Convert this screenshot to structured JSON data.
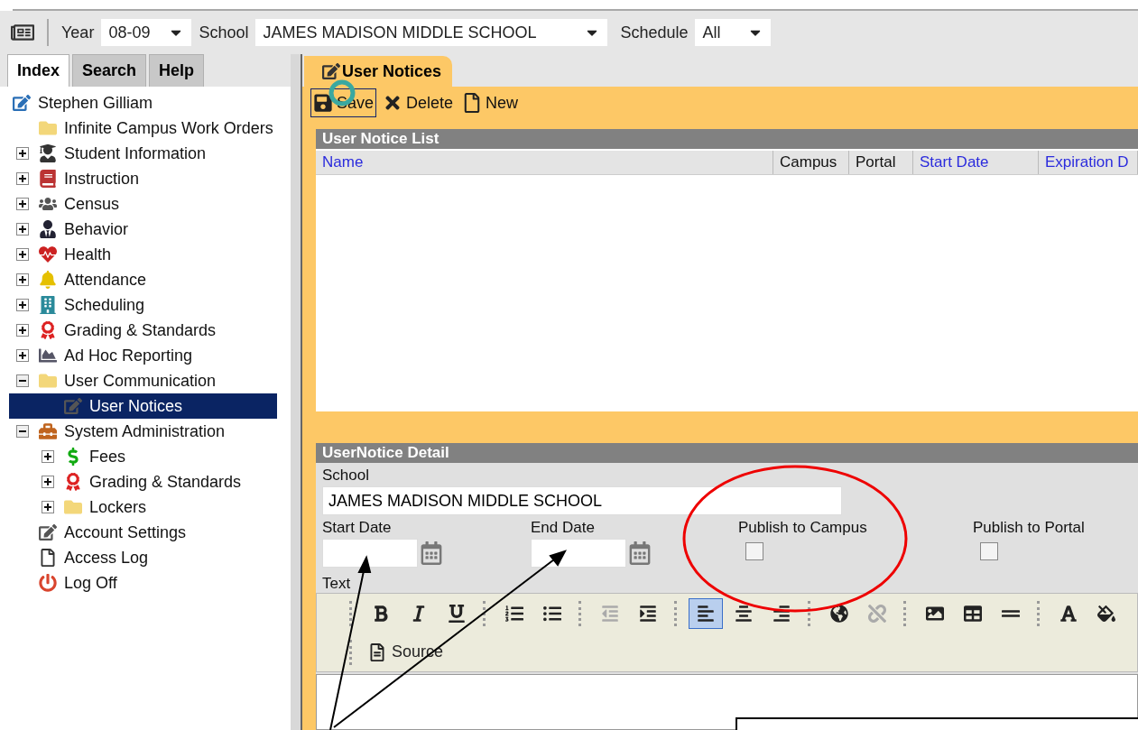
{
  "toolbar": {
    "year": {
      "label": "Year",
      "value": "08-09"
    },
    "school": {
      "label": "School",
      "value": "JAMES MADISON MIDDLE SCHOOL"
    },
    "schedule": {
      "label": "Schedule",
      "value": "All"
    }
  },
  "nav_tabs": [
    {
      "label": "Index",
      "selected": true
    },
    {
      "label": "Search",
      "selected": false
    },
    {
      "label": "Help",
      "selected": false
    }
  ],
  "tree": [
    {
      "label": "Stephen Gilliam",
      "kind": "account",
      "selected": false,
      "children": [
        {
          "label": "Infinite Campus Work Orders",
          "kind": "folder",
          "selected": false
        },
        {
          "label": "Student Information",
          "kind": "student",
          "expanded": false,
          "selected": false
        },
        {
          "label": "Instruction",
          "kind": "notebook",
          "expanded": false,
          "selected": false
        },
        {
          "label": "Census",
          "kind": "census",
          "expanded": false,
          "selected": false
        },
        {
          "label": "Behavior",
          "kind": "behavior",
          "expanded": false,
          "selected": false
        },
        {
          "label": "Health",
          "kind": "health",
          "expanded": false,
          "selected": false
        },
        {
          "label": "Attendance",
          "kind": "bell",
          "expanded": false,
          "selected": false
        },
        {
          "label": "Scheduling",
          "kind": "building",
          "expanded": false,
          "selected": false
        },
        {
          "label": "Grading & Standards",
          "kind": "grade",
          "expanded": false,
          "selected": false
        },
        {
          "label": "Ad Hoc Reporting",
          "kind": "chart",
          "expanded": false,
          "selected": false
        },
        {
          "label": "User Communication",
          "kind": "folder",
          "expanded": true,
          "selected": false,
          "children": [
            {
              "label": "User Notices",
              "kind": "note",
              "selected": true
            }
          ]
        },
        {
          "label": "System Administration",
          "kind": "tools",
          "expanded": true,
          "selected": false,
          "children": [
            {
              "label": "Fees",
              "kind": "dollar",
              "expanded": false,
              "selected": false
            },
            {
              "label": "Grading & Standards",
              "kind": "grade",
              "expanded": false,
              "selected": false
            },
            {
              "label": "Lockers",
              "kind": "folder",
              "expanded": false,
              "selected": false
            }
          ]
        },
        {
          "label": "Account Settings",
          "kind": "note",
          "selected": false
        },
        {
          "label": "Access Log",
          "kind": "page",
          "selected": false
        },
        {
          "label": "Log Off",
          "kind": "power",
          "selected": false
        }
      ]
    }
  ],
  "module_tab": {
    "label": "User Notices",
    "selected": true
  },
  "actions": [
    {
      "label": "Save",
      "kind": "save",
      "focused": true
    },
    {
      "label": "Delete",
      "kind": "delete",
      "focused": false
    },
    {
      "label": "New",
      "kind": "new",
      "focused": false
    }
  ],
  "list": {
    "title": "User Notice List",
    "columns": [
      {
        "label": "Name",
        "sortable": true
      },
      {
        "label": "Campus",
        "sortable": false
      },
      {
        "label": "Portal",
        "sortable": false
      },
      {
        "label": "Start Date",
        "sortable": true
      },
      {
        "label": "Expiration D",
        "sortable": true
      }
    ]
  },
  "detail": {
    "title": "UserNotice Detail",
    "school": {
      "label": "School",
      "value": "JAMES MADISON MIDDLE SCHOOL"
    },
    "dates": [
      {
        "label": "Start Date"
      },
      {
        "label": "End Date"
      }
    ],
    "publish": [
      {
        "label": "Publish to Campus",
        "checked": false
      },
      {
        "label": "Publish to Portal",
        "checked": false
      }
    ],
    "editor": {
      "label": "Text",
      "rows": [
        [
          [
            {
              "kind": "bold",
              "selected": false,
              "disabled": false
            },
            {
              "kind": "italic",
              "selected": false,
              "disabled": false
            },
            {
              "kind": "underline",
              "selected": false,
              "disabled": false
            }
          ],
          [
            {
              "kind": "numbered",
              "selected": false,
              "disabled": false
            },
            {
              "kind": "bulleted",
              "selected": false,
              "disabled": false
            }
          ],
          [
            {
              "kind": "outdent",
              "selected": false,
              "disabled": true
            },
            {
              "kind": "indent",
              "selected": false,
              "disabled": false
            }
          ],
          [
            {
              "kind": "left",
              "selected": true,
              "disabled": false
            },
            {
              "kind": "center",
              "selected": false,
              "disabled": false
            },
            {
              "kind": "right",
              "selected": false,
              "disabled": false
            }
          ],
          [
            {
              "kind": "link",
              "selected": false,
              "disabled": false
            },
            {
              "kind": "unlink",
              "selected": false,
              "disabled": true
            }
          ],
          [
            {
              "kind": "image",
              "selected": false,
              "disabled": false
            },
            {
              "kind": "table",
              "selected": false,
              "disabled": false
            },
            {
              "kind": "rule",
              "selected": false,
              "disabled": false
            }
          ],
          [
            {
              "kind": "textcolor",
              "selected": false,
              "disabled": false
            },
            {
              "kind": "fillcolor",
              "selected": false,
              "disabled": false
            }
          ]
        ],
        [
          [
            {
              "kind": "source",
              "label": "Source",
              "selected": false,
              "disabled": false
            }
          ]
        ]
      ]
    }
  }
}
